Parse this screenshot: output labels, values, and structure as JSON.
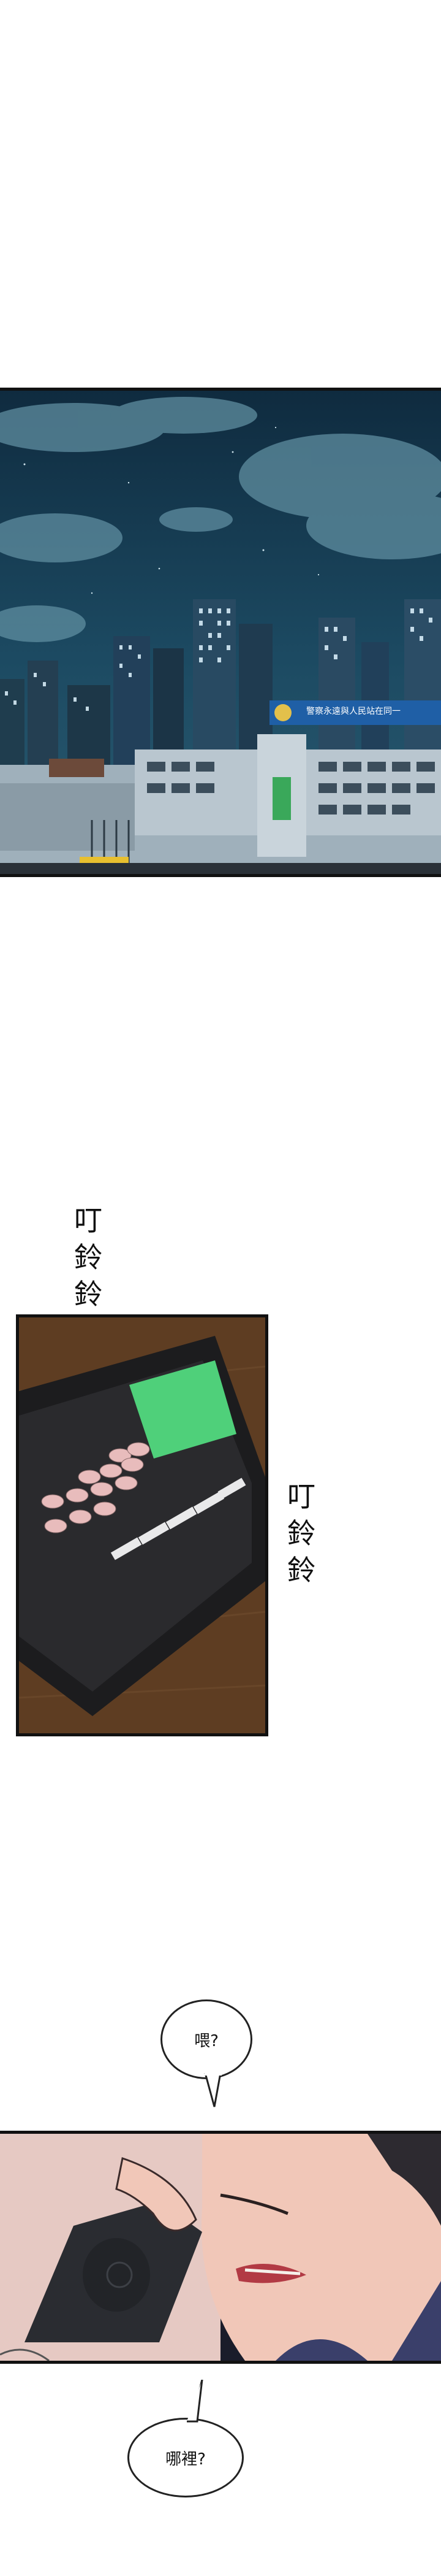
{
  "police_sign": {
    "text": "警察永遠與人民站在同一"
  },
  "sfx_ring_1": {
    "chars": [
      "叮",
      "鈴",
      "鈴"
    ]
  },
  "sfx_ring_2": {
    "chars": [
      "叮",
      "鈴",
      "鈴"
    ]
  },
  "bubble_hello": {
    "text": "喂?"
  },
  "bubble_where": {
    "text": "哪裡?"
  },
  "colors": {
    "night_sky": "#16344a",
    "phone_screen": "#4fd07a",
    "wood": "#5e3d22",
    "skin": "#f1c7b8"
  }
}
